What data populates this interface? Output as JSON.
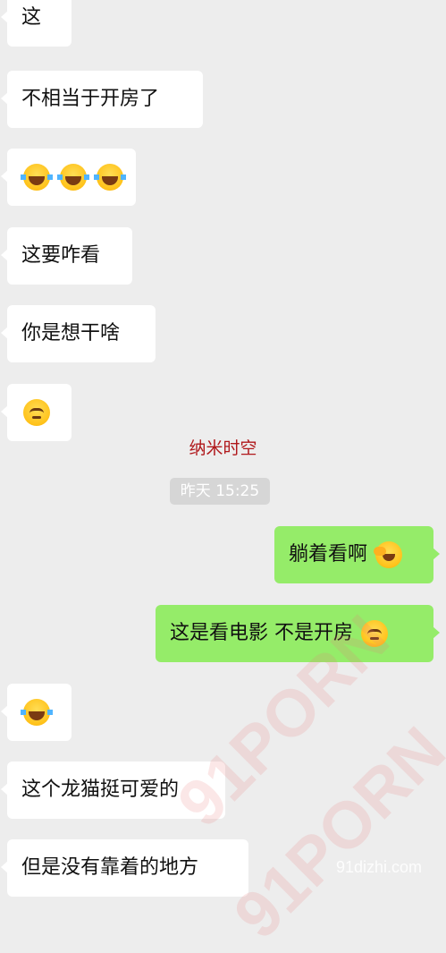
{
  "messages": [
    {
      "side": "left",
      "text": "这"
    },
    {
      "side": "left",
      "text": "不相当于开房了"
    },
    {
      "side": "left",
      "emoji": [
        "laugh",
        "laugh",
        "laugh"
      ]
    },
    {
      "side": "left",
      "text": "这要咋看"
    },
    {
      "side": "left",
      "text": "你是想干啥"
    },
    {
      "side": "left",
      "emoji": [
        "think"
      ]
    },
    {
      "side": "right",
      "text": "躺着看啊"
    },
    {
      "side": "right",
      "text": "这是看电影 不是开房"
    },
    {
      "side": "left",
      "emoji": [
        "laugh"
      ]
    },
    {
      "side": "left",
      "text": "这个龙猫挺可爱的"
    },
    {
      "side": "left",
      "text": "但是没有靠着的地方"
    }
  ],
  "caption": "纳米时空",
  "timestamp": "昨天 15:25",
  "watermark": {
    "text": "91PORN",
    "url": "91dizhi.com"
  },
  "colors": {
    "background": "#ededed",
    "incoming": "#ffffff",
    "outgoing": "#95ec69",
    "caption": "#b0181b"
  }
}
